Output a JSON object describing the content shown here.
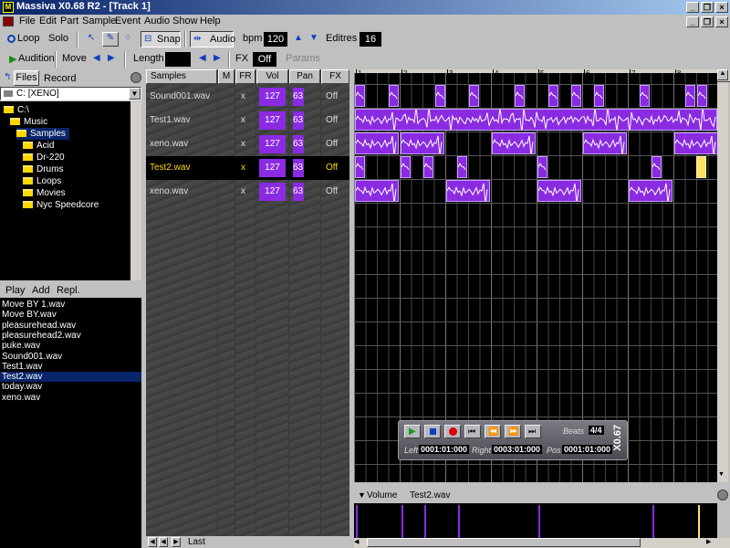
{
  "app": {
    "title": "Massiva X0.68 R2 - [Track 1]",
    "version_badge": "X0.67"
  },
  "menu": [
    "File",
    "Edit",
    "Part",
    "Sample",
    "Event",
    "Audio",
    "Show",
    "Help"
  ],
  "toolbar1": {
    "loop": "Loop",
    "solo": "Solo",
    "snap": "Snap",
    "audio": "Audio",
    "bpm_label": "bpm",
    "bpm": "120",
    "editres_label": "Editres",
    "editres": "16"
  },
  "toolbar2": {
    "audition": "Audition",
    "move": "Move",
    "length_label": "Length",
    "length": "",
    "fx_label": "FX",
    "fx": "Off",
    "params": "Params"
  },
  "left": {
    "tabs": [
      "Files",
      "Record"
    ],
    "drive": "C: [XENO]",
    "tree": [
      {
        "label": "C:\\",
        "indent": 0,
        "selected": false
      },
      {
        "label": "Music",
        "indent": 1,
        "selected": false
      },
      {
        "label": "Samples",
        "indent": 2,
        "selected": true
      },
      {
        "label": "Acid",
        "indent": 3,
        "selected": false
      },
      {
        "label": "Dr-220",
        "indent": 3,
        "selected": false
      },
      {
        "label": "Drums",
        "indent": 3,
        "selected": false
      },
      {
        "label": "Loops",
        "indent": 3,
        "selected": false
      },
      {
        "label": "Movies",
        "indent": 3,
        "selected": false
      },
      {
        "label": "Nyc Speedcore",
        "indent": 3,
        "selected": false
      }
    ],
    "actions": [
      "Play",
      "Add",
      "Repl."
    ],
    "files": [
      "Move BY 1.wav",
      "Move BY.wav",
      "pleasurehead.wav",
      "pleasurehead2.wav",
      "puke.wav",
      "Sound001.wav",
      "Test1.wav",
      "Test2.wav",
      "today.wav",
      "xeno.wav"
    ],
    "selected_file": "Test2.wav"
  },
  "samples": {
    "headers": [
      "Samples",
      "M",
      "FR",
      "Vol",
      "Pan",
      "FX"
    ],
    "rows": [
      {
        "name": "Sound001.wav",
        "fr": "x",
        "vol": "127",
        "pan": "63",
        "fx": "Off",
        "active": false
      },
      {
        "name": "Test1.wav",
        "fr": "x",
        "vol": "127",
        "pan": "63",
        "fx": "Off",
        "active": false
      },
      {
        "name": "xeno.wav",
        "fr": "x",
        "vol": "127",
        "pan": "63",
        "fx": "Off",
        "active": false
      },
      {
        "name": "Test2.wav",
        "fr": "x",
        "vol": "127",
        "pan": "63",
        "fx": "Off",
        "active": true
      },
      {
        "name": "xeno.wav",
        "fr": "x",
        "vol": "127",
        "pan": "63",
        "fx": "Off",
        "active": false
      }
    ],
    "footer": "Last"
  },
  "timeline": {
    "marks": [
      "1",
      "2",
      "3",
      "4",
      "5",
      "6",
      "7",
      "8"
    ]
  },
  "transport": {
    "beats_label": "Beats",
    "beats": "4/4",
    "left_label": "Left",
    "left": "0001:01:000",
    "right_label": "Right",
    "right": "0003:01:000",
    "pos_label": "Pos",
    "pos": "0001:01:000"
  },
  "volume": {
    "label": "Volume",
    "track": "Test2.wav"
  },
  "colors": {
    "accent": "#8a2be2",
    "grid": "#000000",
    "selected": "#0a246a"
  }
}
